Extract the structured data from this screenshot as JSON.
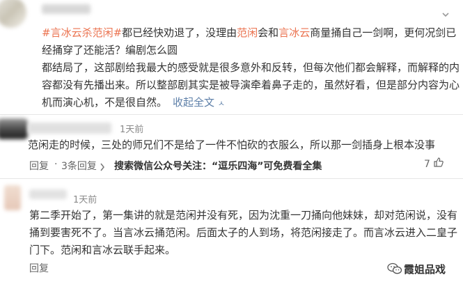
{
  "comment1": {
    "hashtag": "#言冰云杀范闲#",
    "seg1": "都已经快劝退了，没理由",
    "link_fanxian": "范闲",
    "seg2": "会和",
    "link_yanbingyun": "言冰云",
    "seg3": "商量捅自己一剑啊，更何况剑已经捅穿了还能活？编剧怎么圆",
    "para2": "都结局了，这部剧给我最大的感受就是很多意外和反转，但每次他们都会解释，而解释的内容都没有先播出来。所以整部剧其实是被导演牵着鼻子走的，虽然好看，但是部分内容为心机而演心机，不是很自然。",
    "fold_label": "收起全文",
    "fold_arrow": "ㅅ"
  },
  "comment2": {
    "time": "1天前",
    "text": "范闲走的时候，三处的师兄们不是给了一件不怕砍的衣服么，所以那一剑插身上根本没事",
    "reply": "回复",
    "replies": "3条回复",
    "promo": "搜索微信公众号关注：“逗乐四海”可免费看全集",
    "likes": "7"
  },
  "comment3": {
    "time": "1天前",
    "text": "第二季开始了，第一集讲的就是范闲并没有死，因为沈重一刀捅向他妹妹，却对范闲说，没有捅到要害死不了。当言冰云捅范闲。后面太子的人到场，将范闲接走了。而言冰云进入二皇子门下。范闲和言冰云联手起来。",
    "reply": "回复"
  },
  "watermark": "霞姐品戏"
}
